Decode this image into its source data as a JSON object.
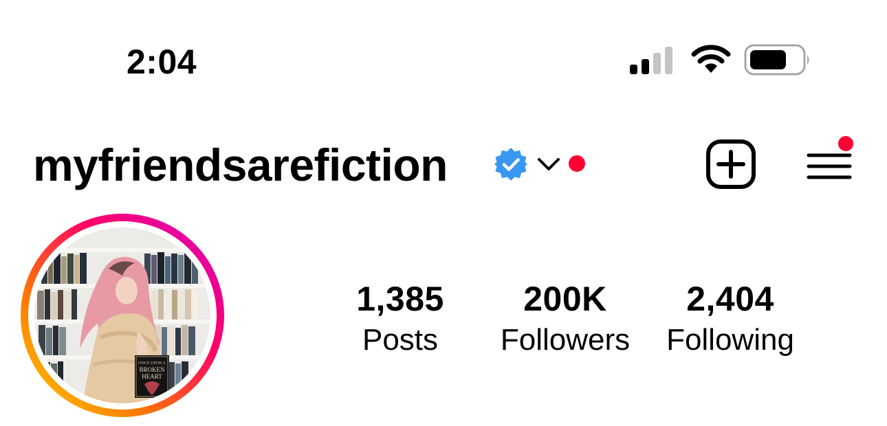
{
  "status_bar": {
    "time": "2:04",
    "icons": [
      "signal-icon",
      "wifi-icon",
      "battery-icon"
    ]
  },
  "header": {
    "username": "myfriendsarefiction",
    "verified": true,
    "icons": [
      "verified-badge-icon",
      "chevron-down-icon",
      "create-post-icon",
      "menu-icon"
    ]
  },
  "avatar": {
    "book_title": "ONCE UPON A BROKEN HEART",
    "has_story_ring": true
  },
  "stats": {
    "posts": {
      "count": "1,385",
      "label": "Posts"
    },
    "followers": {
      "count": "200K",
      "label": "Followers"
    },
    "following": {
      "count": "2,404",
      "label": "Following"
    }
  },
  "colors": {
    "notification_dot": "#ff0033",
    "verified_badge": "#3897f0",
    "story_ring": [
      "#ffd600",
      "#ff7a00",
      "#ff0069",
      "#d300c5"
    ]
  }
}
